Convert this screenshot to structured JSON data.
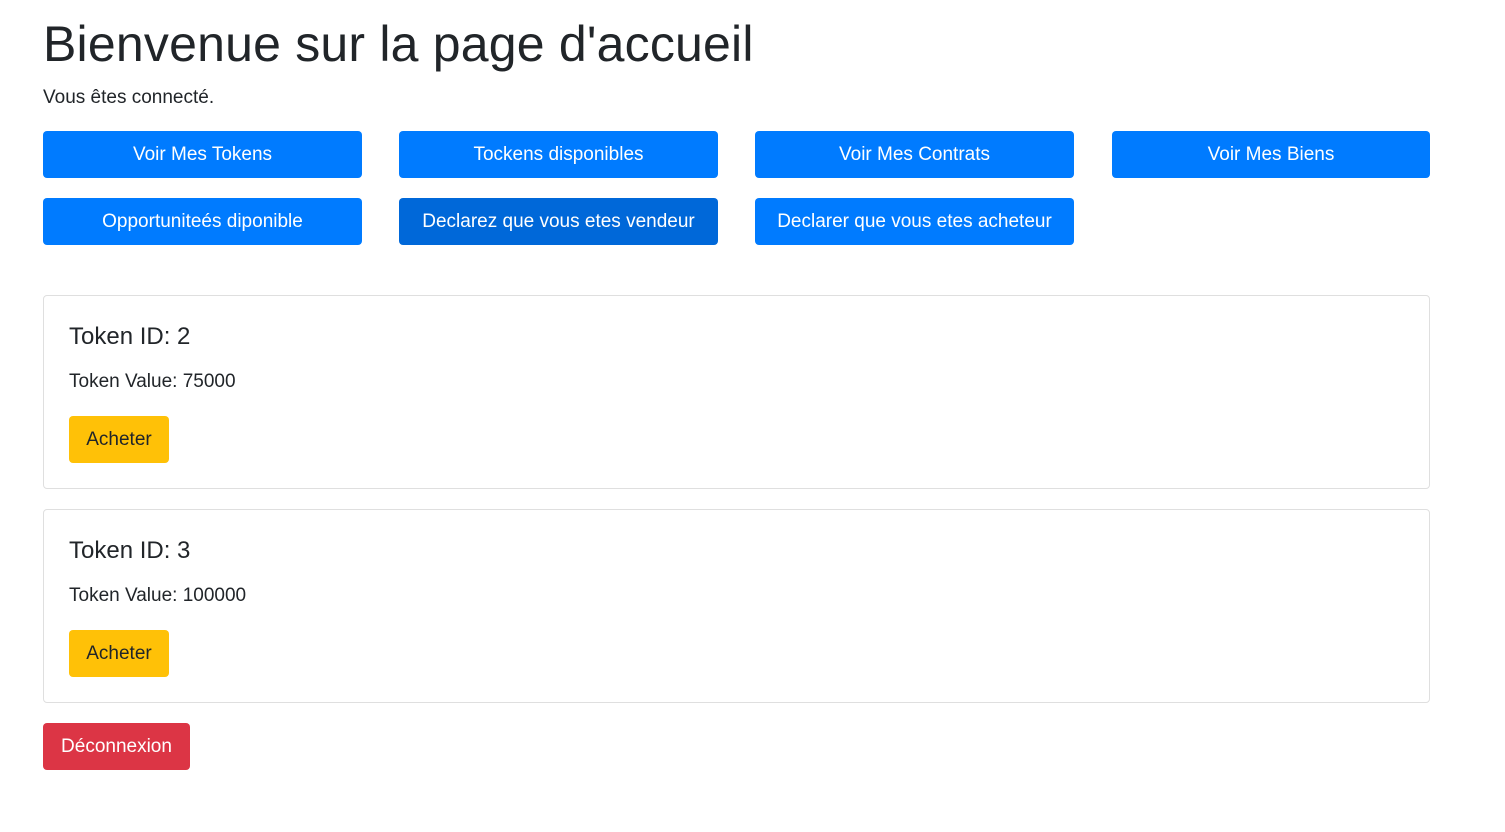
{
  "page": {
    "title": "Bienvenue sur la page d'accueil",
    "subtitle": "Vous êtes connecté."
  },
  "nav_buttons": {
    "row1": [
      {
        "label": "Voir Mes Tokens"
      },
      {
        "label": "Tockens disponibles"
      },
      {
        "label": "Voir Mes Contrats"
      },
      {
        "label": "Voir Mes Biens"
      }
    ],
    "row2": [
      {
        "label": "Opportuniteés diponible"
      },
      {
        "label": "Declarez que vous etes vendeur"
      },
      {
        "label": "Declarer que vous etes acheteur"
      }
    ]
  },
  "tokens": [
    {
      "title": "Token ID: 2",
      "value_text": "Token Value: 75000",
      "button_label": "Acheter"
    },
    {
      "title": "Token ID: 3",
      "value_text": "Token Value: 100000",
      "button_label": "Acheter"
    }
  ],
  "logout_label": "Déconnexion",
  "colors": {
    "primary": "#007bff",
    "primary_active": "#0068d9",
    "warning": "#ffc107",
    "danger": "#dc3545",
    "text": "#212529"
  }
}
